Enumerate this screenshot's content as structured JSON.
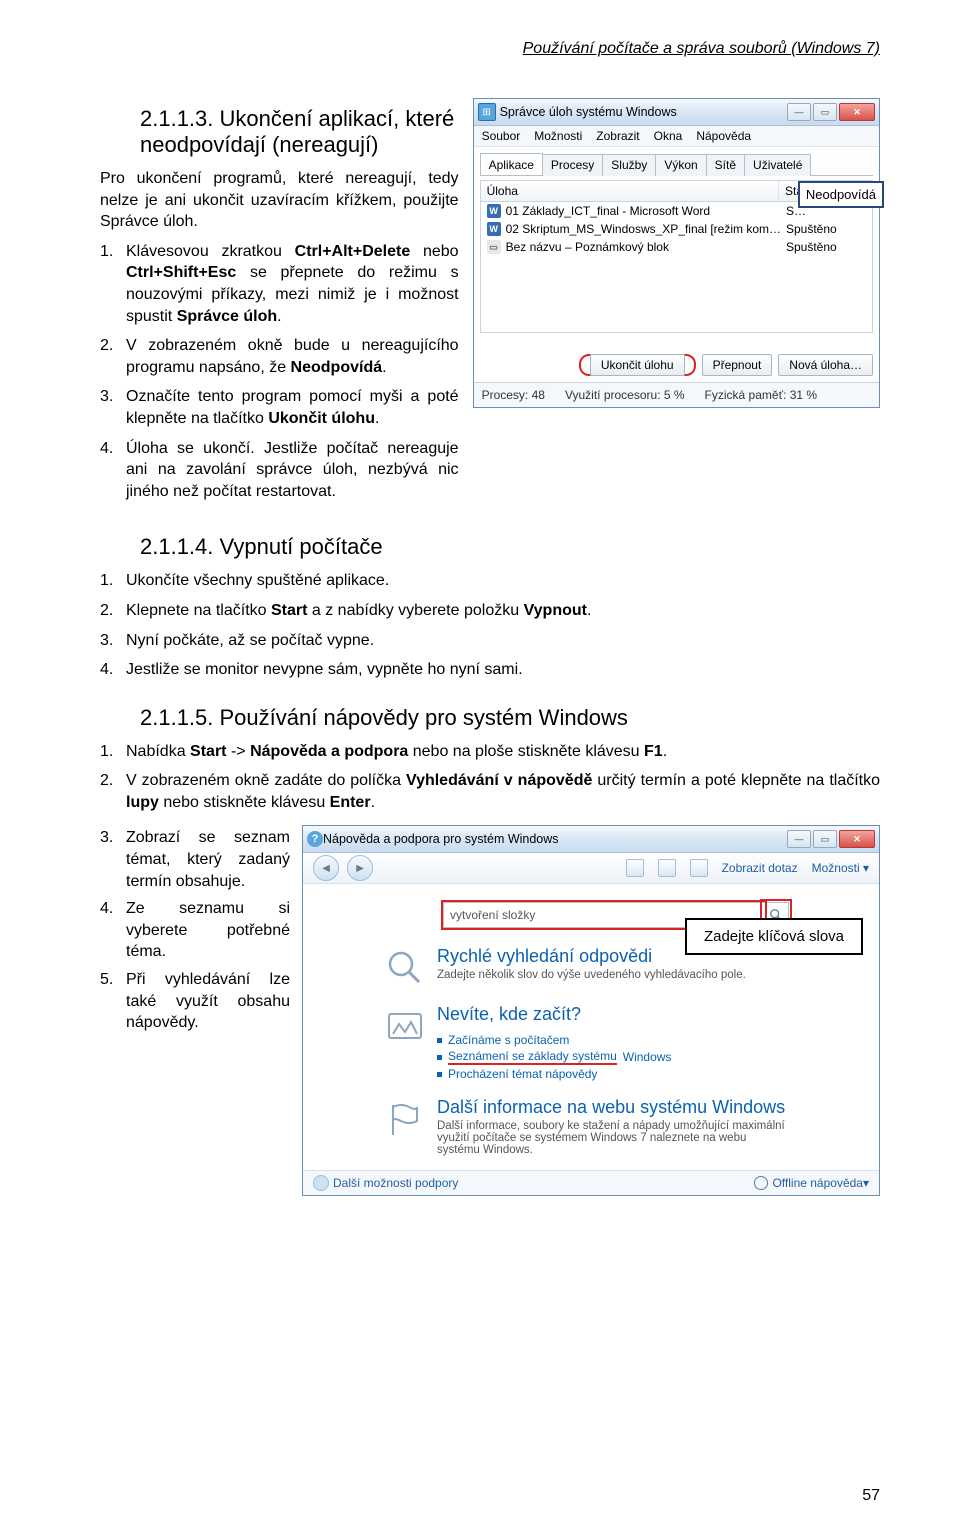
{
  "header": "Používání počítače a správa souborů (Windows 7)",
  "page_number": "57",
  "s1": {
    "heading": "2.1.1.3. Ukončení aplikací, které neodpovídají (nereagují)",
    "intro": "Pro ukončení programů, které nereagují, tedy nelze je ani ukončit uzavíracím křížkem, použijte Správce úloh.",
    "li1_a": "Klávesovou zkratkou ",
    "li1_b": "Ctrl+Alt+Delete",
    "li1_c": " nebo ",
    "li1_d": "Ctrl+Shift+Esc",
    "li1_e": " se přepnete do režimu s nouzovými příkazy, mezi nimiž je i možnost spustit ",
    "li1_f": "Správce úloh",
    "li1_g": ".",
    "li2_a": "V zobrazeném okně bude u nereagujícího programu napsáno, že ",
    "li2_b": "Neodpovídá",
    "li2_c": ".",
    "li3_a": "Označíte tento program pomocí myši a poté klepněte na tlačítko ",
    "li3_b": "Ukončit úlohu",
    "li3_c": ".",
    "li4": "Úloha se ukončí. Jestliže počítač nereaguje ani na zavolání správce úloh, nezbývá nic jiného než počítat restartovat."
  },
  "tm": {
    "title": "Správce úloh systému Windows",
    "menu": [
      "Soubor",
      "Možnosti",
      "Zobrazit",
      "Okna",
      "Nápověda"
    ],
    "tabs": [
      "Aplikace",
      "Procesy",
      "Služby",
      "Výkon",
      "Sítě",
      "Uživatelé"
    ],
    "col1": "Úloha",
    "col2": "Stav",
    "rows": [
      {
        "ico": "W",
        "name": "01 Základy_ICT_final - Microsoft Word",
        "stat": "S…"
      },
      {
        "ico": "W",
        "name": "02 Skriptum_MS_Windosws_XP_final [režim kom…",
        "stat": "Spuštěno"
      },
      {
        "ico": "N",
        "name": "Bez názvu – Poznámkový blok",
        "stat": "Spuštěno"
      }
    ],
    "callout": "Neodpovídá",
    "btns": [
      "Ukončit úlohu",
      "Přepnout",
      "Nová úloha…"
    ],
    "status": [
      "Procesy: 48",
      "Využití procesoru: 5 %",
      "Fyzická paměť: 31 %"
    ]
  },
  "s2": {
    "heading": "2.1.1.4. Vypnutí počítače",
    "li1": "Ukončíte všechny spuštěné aplikace.",
    "li2_a": "Klepnete na tlačítko ",
    "li2_b": "Start",
    "li2_c": " a z nabídky vyberete položku ",
    "li2_d": "Vypnout",
    "li2_e": ".",
    "li3": "Nyní počkáte, až se počítač vypne.",
    "li4": "Jestliže se monitor nevypne sám, vypněte ho nyní sami."
  },
  "s3": {
    "heading": "2.1.1.5. Používání nápovědy pro systém Windows",
    "li1_a": "Nabídka ",
    "li1_b": "Start",
    "li1_c": " -> ",
    "li1_d": "Nápověda a podpora",
    "li1_e": " nebo na ploše stiskněte klávesu ",
    "li1_f": "F1",
    "li1_g": ".",
    "li2_a": "V zobrazeném okně zadáte do políčka ",
    "li2_b": "Vyhledávání v nápovědě",
    "li2_c": " určitý termín a poté klepněte na tlačítko ",
    "li2_d": "lupy",
    "li2_e": " nebo stiskněte klávesu ",
    "li2_f": "Enter",
    "li2_g": ".",
    "li3": "Zobrazí se seznam témat, který zadaný termín obsahuje.",
    "li4": "Ze seznamu si vyberete potřebné téma.",
    "li5": "Při vyhledávání lze také využít obsahu nápovědy."
  },
  "help": {
    "title": "Nápověda a podpora pro systém Windows",
    "toolbar": {
      "show": "Zobrazit dotaz",
      "opts": "Možnosti"
    },
    "search_value": "vytvoření složky",
    "keywords_box": "Zadejte klíčová slova",
    "h1": "Rychlé vyhledání odpovědi",
    "h1d": "Zadejte několik slov do výše uvedeného vyhledávacího pole.",
    "h2": "Nevíte, kde začít?",
    "links": [
      "Začínáme s počítačem",
      "Seznámení se základy systému",
      "Procházení témat nápovědy"
    ],
    "link2_suffix": " Windows",
    "h3": "Další informace na webu systému Windows",
    "h3d": "Další informace, soubory ke stažení a nápady umožňující maximální využití počítače se systémem Windows 7 naleznete na webu systému Windows.",
    "status_left": "Další možnosti podpory",
    "status_right": "Offline nápověda"
  }
}
